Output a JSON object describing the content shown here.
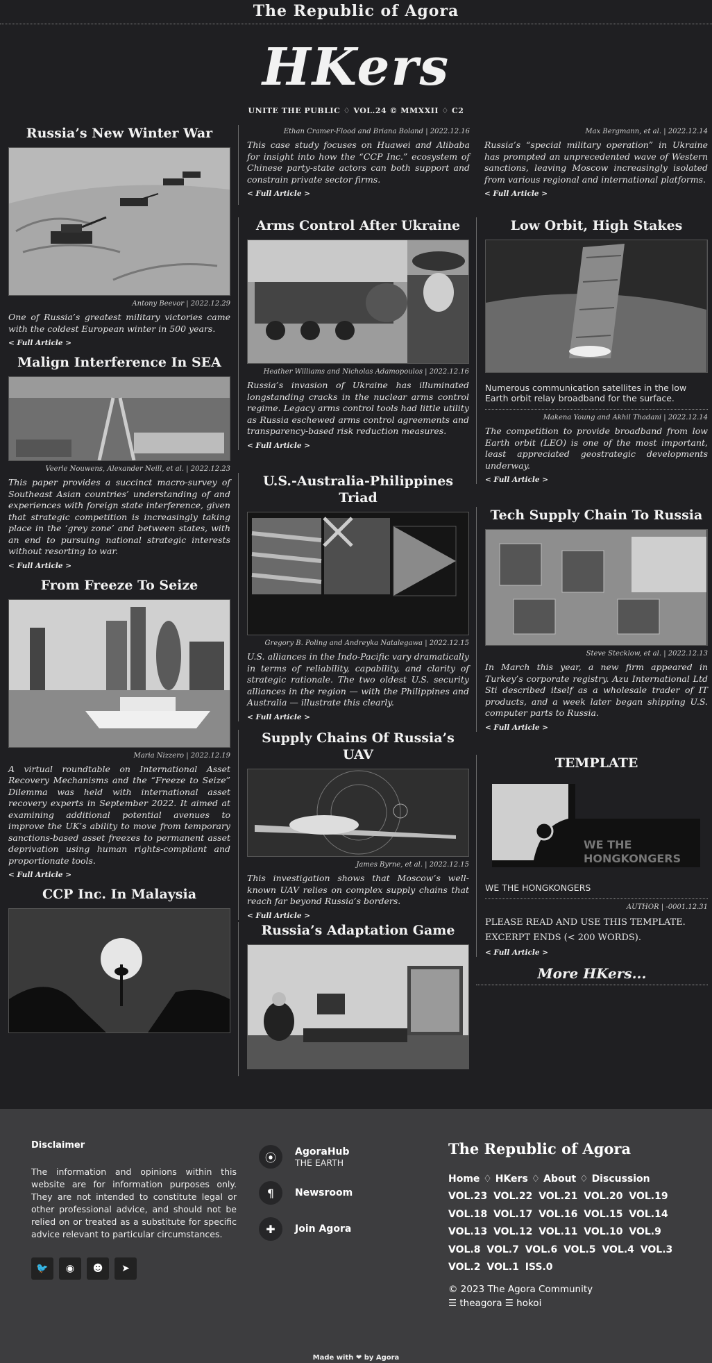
{
  "header": {
    "republic_title": "The Republic of Agora",
    "logo": "HKers",
    "tagline": "UNITE THE PUBLIC ♢ VOL.24 © MMXXII ♢ C2"
  },
  "articles": {
    "a1": {
      "title": "Russia’s New Winter War",
      "byline": "Antony Beevor | 2022.12.29",
      "excerpt": "One of Russia’s greatest military victories came with the coldest European winter in 500 years.",
      "link": "< Full Article >"
    },
    "a2": {
      "title": "Malign Interference In SEA",
      "byline": "Veerle Nouwens, Alexander Neill, et al. | 2022.12.23",
      "excerpt": "This paper provides a succinct macro-survey of Southeast Asian countries’ understanding of and experiences with foreign state interference, given that strategic competition is increasingly taking place in the ‘grey zone’ and between states, with an end to pursuing national strategic interests without resorting to war.",
      "link": "< Full Article >"
    },
    "a3": {
      "title": "From Freeze To Seize",
      "byline": "Maria Nizzero | 2022.12.19",
      "excerpt": "A virtual roundtable on International Asset Recovery Mechanisms and the “Freeze to Seize” Dilemma was held with international asset recovery experts in September 2022. It aimed at examining additional potential avenues to improve the UK’s ability to move from temporary sanctions-based asset freezes to permanent asset deprivation using human rights-compliant and proportionate tools.",
      "link": "< Full Article >"
    },
    "a4": {
      "title": "CCP Inc. In Malaysia"
    },
    "b0": {
      "byline": "Ethan Cramer-Flood and Briana Boland | 2022.12.16",
      "excerpt": "This case study focuses on Huawei and Alibaba for insight into how the “CCP Inc.” ecosystem of Chinese party-state actors can both support and constrain private sector firms.",
      "link": "< Full Article >"
    },
    "b1": {
      "title": "Arms Control After Ukraine",
      "byline": "Heather Williams and Nicholas Adamopoulos | 2022.12.16",
      "excerpt": "Russia’s invasion of Ukraine has illuminated longstanding cracks in the nuclear arms control regime. Legacy arms control tools had little utility as Russia eschewed arms control agreements and transparency-based risk reduction measures.",
      "link": "< Full Article >"
    },
    "b2": {
      "title": "U.S.-Australia-Philippines Triad",
      "byline": "Gregory B. Poling and Andreyka Natalegawa | 2022.12.15",
      "excerpt": "U.S. alliances in the Indo-Pacific vary dramatically in terms of reliability, capability, and clarity of strategic rationale. The two oldest U.S. security alliances in the region — with the Philippines and Australia — illustrate this clearly.",
      "link": "< Full Article >"
    },
    "b3": {
      "title": "Supply Chains Of Russia’s UAV",
      "byline": "James Byrne, et al. | 2022.12.15",
      "excerpt": "This investigation shows that Moscow’s well-known UAV relies on complex supply chains that reach far beyond Russia’s borders.",
      "link": "< Full Article >"
    },
    "b4": {
      "title": "Russia’s Adaptation Game"
    },
    "c0": {
      "byline": "Max Bergmann, et al. | 2022.12.14",
      "excerpt": "Russia’s “special military operation” in Ukraine has prompted an unprecedented wave of Western sanctions, leaving Moscow increasingly isolated from various regional and international platforms.",
      "link": "< Full Article >"
    },
    "c1": {
      "title": "Low Orbit, High Stakes",
      "caption": "Numerous communication satellites in the low Earth orbit relay broadband for the surface.",
      "byline": "Makena Young and Akhil Thadani | 2022.12.14",
      "excerpt": "The competition to provide broadband from low Earth orbit (LEO) is one of the most important, least appreciated geostrategic developments underway.",
      "link": "< Full Article >"
    },
    "c2": {
      "title": "Tech Supply Chain To Russia",
      "byline": "Steve Stecklow, et al. | 2022.12.13",
      "excerpt": "In March this year, a new firm appeared in Turkey’s corporate registry. Azu International Ltd Sti described itself as a wholesale trader of IT products, and a week later began shipping U.S. computer parts to Russia.",
      "link": "< Full Article >"
    },
    "c3": {
      "title": "TEMPLATE",
      "image_text": "WE THE HONGKONGERS",
      "caption": "WE THE HONGKONGERS",
      "byline": "AUTHOR | -0001.12.31",
      "line1": "PLEASE READ AND USE THIS TEMPLATE.",
      "line2": "EXCERPT ENDS (< 200 WORDS).",
      "link": "< Full Article >"
    }
  },
  "more": "More HKers...",
  "footer": {
    "disclaimer_title": "Disclaimer",
    "disclaimer_text": "The information and opinions within this website are for information purposes only. They are not intended to constitute legal or other professional advice, and should not be relied on or treated as a substitute for specific advice relevant to particular circumstances.",
    "social_icons": [
      "twitter-icon",
      "github-icon",
      "reddit-icon",
      "telegram-icon"
    ],
    "hub_label": "AgoraHub",
    "hub_sub": "THE EARTH",
    "newsroom": "Newsroom",
    "join": "Join Agora",
    "brand": "The Republic of Agora",
    "nav": [
      "Home",
      "HKers",
      "About",
      "Discussion"
    ],
    "nav_sep": "♢",
    "vols": [
      "VOL.23",
      "VOL.22",
      "VOL.21",
      "VOL.20",
      "VOL.19",
      "VOL.18",
      "VOL.17",
      "VOL.16",
      "VOL.15",
      "VOL.14",
      "VOL.13",
      "VOL.12",
      "VOL.11",
      "VOL.10",
      "VOL.9",
      "VOL.8",
      "VOL.7",
      "VOL.6",
      "VOL.5",
      "VOL.4",
      "VOL.3",
      "VOL.2",
      "VOL.1",
      "ISS.0"
    ],
    "copyright": "© 2023 The Agora Community",
    "links": "☰ theagora ☰ hokoi",
    "made_with": "Made with ❤ by Agora"
  }
}
